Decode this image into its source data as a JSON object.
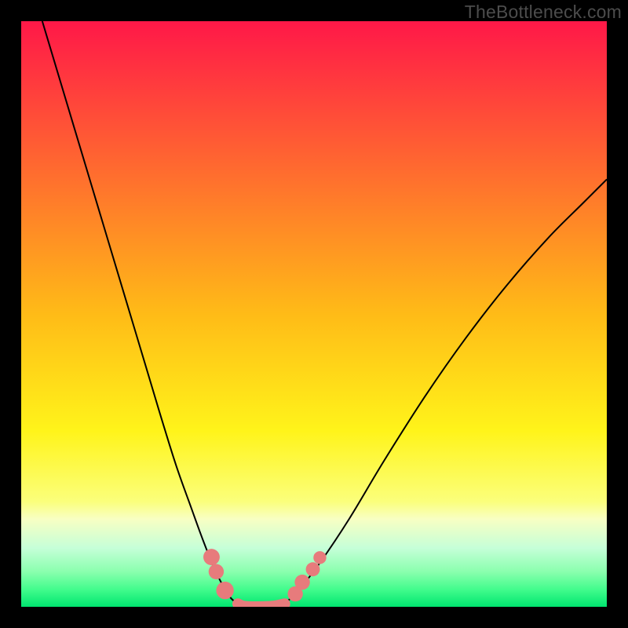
{
  "watermark": "TheBottleneck.com",
  "chart_data": {
    "type": "line",
    "title": "",
    "xlabel": "",
    "ylabel": "",
    "xlim": [
      0,
      1
    ],
    "ylim": [
      0,
      1
    ],
    "background": {
      "type": "vertical_gradient",
      "stops": [
        {
          "offset": 0.0,
          "color": "#ff1848"
        },
        {
          "offset": 0.5,
          "color": "#ffbb17"
        },
        {
          "offset": 0.7,
          "color": "#fff41a"
        },
        {
          "offset": 0.82,
          "color": "#fbff7b"
        },
        {
          "offset": 0.85,
          "color": "#f8ffc3"
        },
        {
          "offset": 0.9,
          "color": "#c5ffd8"
        },
        {
          "offset": 0.94,
          "color": "#8affae"
        },
        {
          "offset": 0.97,
          "color": "#43fc8d"
        },
        {
          "offset": 1.0,
          "color": "#00e56f"
        }
      ]
    },
    "series": [
      {
        "name": "left_branch",
        "stroke": "#000000",
        "stroke_width": 2,
        "x": [
          0.036,
          0.06,
          0.09,
          0.12,
          0.15,
          0.18,
          0.21,
          0.24,
          0.265,
          0.29,
          0.31,
          0.33,
          0.345,
          0.358,
          0.37
        ],
        "y": [
          1.0,
          0.92,
          0.82,
          0.72,
          0.62,
          0.52,
          0.42,
          0.32,
          0.24,
          0.17,
          0.115,
          0.065,
          0.035,
          0.015,
          0.005
        ]
      },
      {
        "name": "right_branch",
        "stroke": "#000000",
        "stroke_width": 2,
        "x": [
          0.45,
          0.475,
          0.51,
          0.56,
          0.62,
          0.69,
          0.76,
          0.83,
          0.9,
          0.96,
          1.0
        ],
        "y": [
          0.005,
          0.03,
          0.075,
          0.15,
          0.25,
          0.36,
          0.46,
          0.55,
          0.63,
          0.69,
          0.73
        ]
      },
      {
        "name": "valley_floor",
        "stroke": "#e77b7c",
        "stroke_width": 14,
        "linecap": "round",
        "x": [
          0.37,
          0.38,
          0.4,
          0.43,
          0.45
        ],
        "y": [
          0.005,
          0.001,
          0.0,
          0.001,
          0.005
        ]
      }
    ],
    "decorative_blobs": [
      {
        "color": "#e77b7c",
        "cx": 0.325,
        "cy": 0.085,
        "r": 0.014
      },
      {
        "color": "#e77b7c",
        "cx": 0.333,
        "cy": 0.06,
        "r": 0.013
      },
      {
        "color": "#e77b7c",
        "cx": 0.348,
        "cy": 0.028,
        "r": 0.015
      },
      {
        "color": "#e77b7c",
        "cx": 0.468,
        "cy": 0.022,
        "r": 0.013
      },
      {
        "color": "#e77b7c",
        "cx": 0.48,
        "cy": 0.042,
        "r": 0.013
      },
      {
        "color": "#e77b7c",
        "cx": 0.498,
        "cy": 0.064,
        "r": 0.012
      },
      {
        "color": "#e77b7c",
        "cx": 0.51,
        "cy": 0.084,
        "r": 0.011
      }
    ]
  }
}
